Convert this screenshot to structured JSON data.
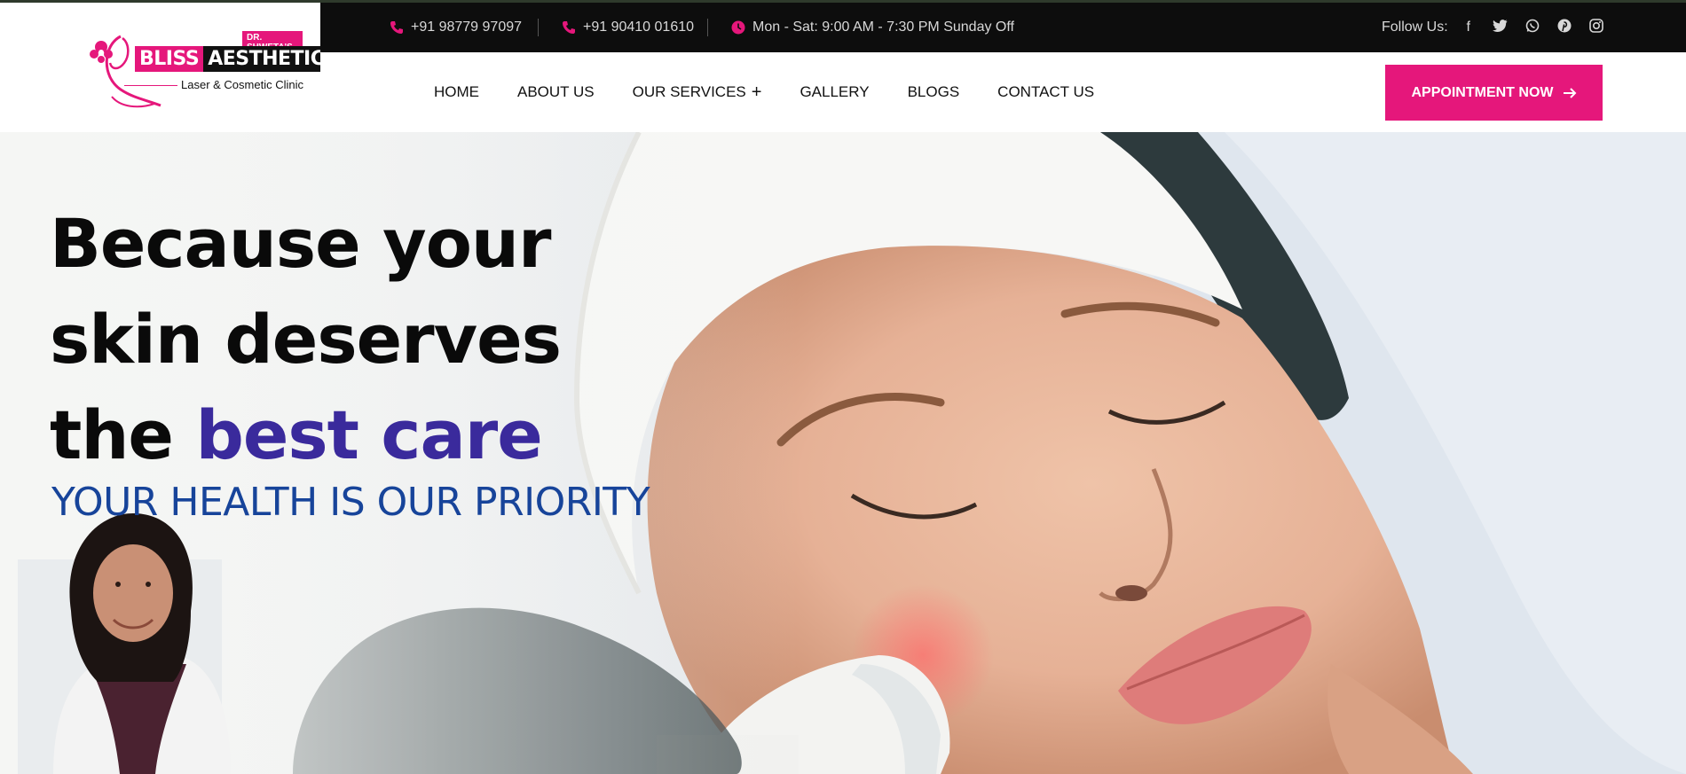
{
  "header": {
    "logo": {
      "prefix": "DR. SHWETA'S",
      "brand_first": "BLISS",
      "brand_second": "AESTHETIC",
      "tagline": "Laser & Cosmetic Clinic"
    },
    "topbar": {
      "phone1": "+91 98779 97097",
      "phone2": "+91 90410 01610",
      "hours": "Mon - Sat: 9:00 AM - 7:30 PM Sunday Off",
      "follow_label": "Follow Us:",
      "social_icons": [
        "facebook-icon",
        "twitter-icon",
        "whatsapp-icon",
        "pinterest-icon",
        "instagram-icon"
      ]
    },
    "nav": {
      "home": "HOME",
      "about": "ABOUT US",
      "services": "OUR SERVICES",
      "gallery": "GALLERY",
      "blogs": "BLOGS",
      "contact": "CONTACT US"
    },
    "cta_label": "APPOINTMENT NOW"
  },
  "hero": {
    "line1": "Because your",
    "line2": "skin deserves",
    "line3_plain": "the ",
    "line3_accent": "best care",
    "subline": "YOUR HEALTH IS OUR PRIORITY"
  },
  "colors": {
    "brand_pink": "#e5177b",
    "topbar_bg": "#0d0d0d",
    "accent_purple": "#3a2a9c",
    "subline_blue": "#17449a"
  }
}
